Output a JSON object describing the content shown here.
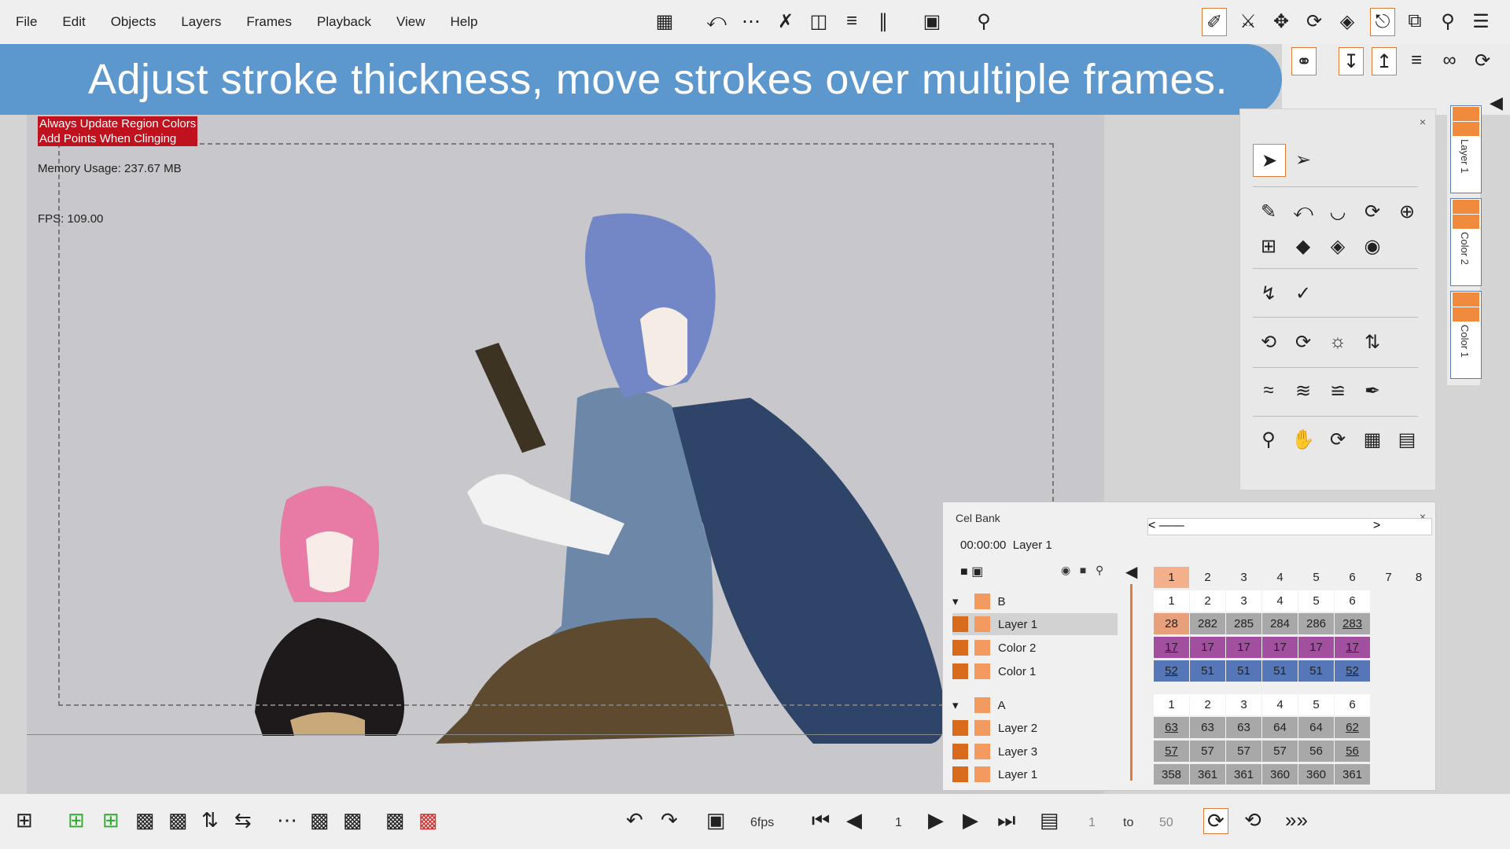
{
  "menu": [
    "File",
    "Edit",
    "Objects",
    "Layers",
    "Frames",
    "Playback",
    "View",
    "Help"
  ],
  "banner": {
    "text": "Adjust stroke thickness, move strokes over multiple frames."
  },
  "warnings": [
    "Always Update Region Colors",
    "Add Points When Clinging"
  ],
  "stats": {
    "memory": "Memory Usage: 237.67 MB",
    "fps": "FPS: 109.00"
  },
  "layers_strip": [
    "Layer 1",
    "Color 2",
    "Color 1"
  ],
  "cel_bank": {
    "title": "Cel Bank",
    "time": "00:00:00",
    "layer": "Layer 1",
    "frame_numbers": [
      "1",
      "2",
      "3",
      "4",
      "5",
      "6",
      "7",
      "8"
    ],
    "groups": [
      {
        "name": "B",
        "rows": [
          {
            "name": "Layer 1",
            "cells": [
              "28",
              "282",
              "285",
              "284",
              "286",
              "283"
            ]
          },
          {
            "name": "Color 2",
            "cells": [
              "17",
              "17",
              "17",
              "17",
              "17",
              "17"
            ]
          },
          {
            "name": "Color 1",
            "cells": [
              "52",
              "51",
              "51",
              "51",
              "51",
              "52"
            ]
          }
        ]
      },
      {
        "name": "A",
        "rows": [
          {
            "name": "Layer 2",
            "cells": [
              "63",
              "63",
              "63",
              "64",
              "64",
              "62"
            ]
          },
          {
            "name": "Layer 3",
            "cells": [
              "57",
              "57",
              "57",
              "57",
              "56",
              "56"
            ]
          },
          {
            "name": "Layer 1",
            "cells": [
              "358",
              "361",
              "361",
              "360",
              "360",
              "361"
            ]
          }
        ]
      }
    ],
    "col_headers": [
      "1",
      "2",
      "3",
      "4",
      "5",
      "6"
    ]
  },
  "playback": {
    "fps": "6fps",
    "frame": "1",
    "range_start": "1",
    "to_label": "to",
    "range_end": "50"
  },
  "colors": {
    "accent": "#e07b39",
    "banner": "#468ccd",
    "layer1_cell": "#999999",
    "color2_cell": "#a24fa0",
    "color1_cell": "#5577b8"
  }
}
